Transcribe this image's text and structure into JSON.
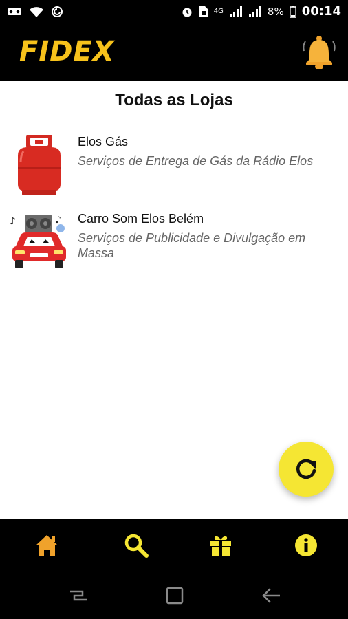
{
  "status_bar": {
    "battery_percent": "8%",
    "time": "00:14",
    "icons": [
      "voicemail-icon",
      "wifi-icon",
      "sync-icon",
      "alarm-icon",
      "sim-icon",
      "4g-icon",
      "signal-icon",
      "signal-icon",
      "battery-icon"
    ]
  },
  "app_bar": {
    "logo": "FIDEX",
    "notification_icon": "bell-icon"
  },
  "page": {
    "title": "Todas as Lojas"
  },
  "stores": [
    {
      "name": "Elos Gás",
      "description": "Serviços de Entrega de Gás da Rádio Elos",
      "icon": "gas-cylinder-icon"
    },
    {
      "name": "Carro Som Elos Belém",
      "description": "Serviços de Publicidade e Divulgação em Massa",
      "icon": "sound-car-icon"
    }
  ],
  "fab": {
    "icon": "refresh-icon"
  },
  "bottom_nav": [
    {
      "icon": "home-icon",
      "active": true
    },
    {
      "icon": "search-icon",
      "active": false
    },
    {
      "icon": "gift-icon",
      "active": false
    },
    {
      "icon": "info-icon",
      "active": false
    }
  ],
  "colors": {
    "brand": "#f7c21b",
    "nav_active": "#f0a22b",
    "nav_icon": "#f5e633",
    "fab": "#f5e633",
    "bar_bg": "#000000"
  }
}
